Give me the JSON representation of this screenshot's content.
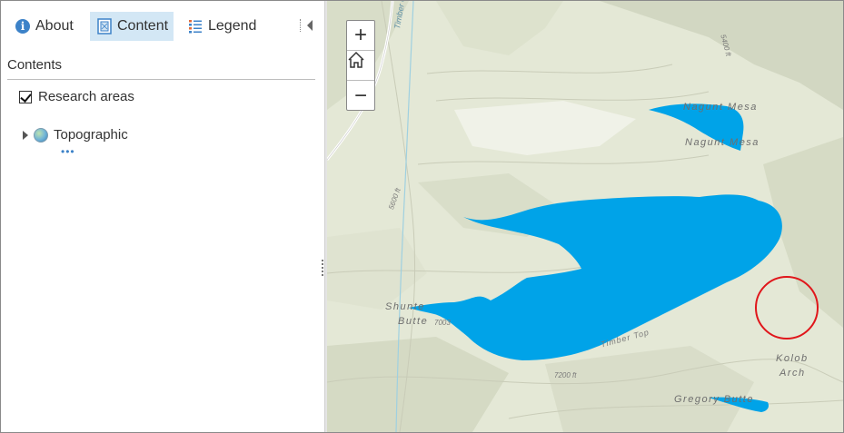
{
  "tabs": [
    {
      "label": "About",
      "icon": "info-icon"
    },
    {
      "label": "Content",
      "icon": "content-icon",
      "selected": true
    },
    {
      "label": "Legend",
      "icon": "legend-icon"
    }
  ],
  "contents": {
    "title": "Contents",
    "layers": [
      {
        "label": "Research areas",
        "checked": true
      },
      {
        "label": "Topographic",
        "icon": "basemap-globe-icon",
        "expanded": false
      }
    ]
  },
  "map": {
    "zoom_in": "+",
    "zoom_out": "−",
    "labels": {
      "creek": "Timber Cre",
      "nagunt_1": "Nagunt Mesa",
      "nagunt_2": "Nagunt Mesa",
      "shunte_1": "Shunte",
      "shunte_2": "Butte",
      "shunte_elev": "7003",
      "kolob_1": "Kolob",
      "kolob_2": "Arch",
      "gregory": "Gregory Butte",
      "elev_5400": "5400 ft",
      "elev_5600": "5600 ft",
      "elev_7200": "7200 ft",
      "ridge": "Timber Top"
    },
    "colors": {
      "water_polygon": "#00a3e8",
      "highlight_circle": "#e0161b",
      "terrain": "#e6ead8"
    }
  }
}
